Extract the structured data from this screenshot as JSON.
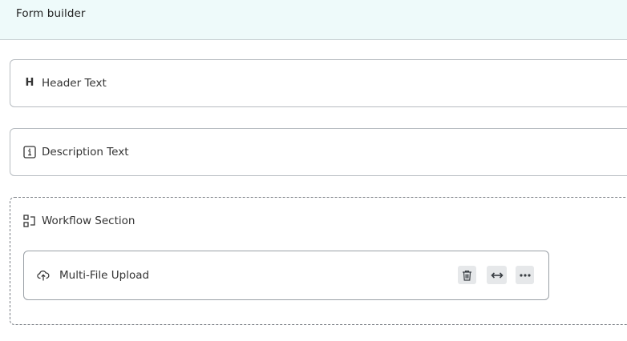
{
  "header": {
    "title": "Form builder"
  },
  "blocks": [
    {
      "label": "Header Text",
      "icon": "heading-icon",
      "icon_glyph": "H"
    },
    {
      "label": "Description Text",
      "icon": "info-icon"
    }
  ],
  "section": {
    "label": "Workflow Section",
    "icon": "workflow-section-icon",
    "children": [
      {
        "label": "Multi-File Upload",
        "icon": "cloud-upload-icon",
        "actions": [
          "trash-icon",
          "resize-horizontal-icon",
          "more-horizontal-icon"
        ]
      }
    ]
  },
  "colors": {
    "header_bg": "#eefafa",
    "border": "#b7bcc1",
    "action_bg": "#e6e8ea"
  }
}
